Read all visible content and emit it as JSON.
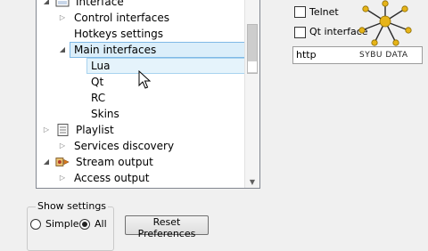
{
  "tree": {
    "items": [
      {
        "label": "Interface",
        "indent": 0,
        "arrow": "expanded",
        "icon": "interface-icon"
      },
      {
        "label": "Control interfaces",
        "indent": 1,
        "arrow": "collapsed"
      },
      {
        "label": "Hotkeys settings",
        "indent": 1,
        "arrow": "none"
      },
      {
        "label": "Main interfaces",
        "indent": 1,
        "arrow": "expanded",
        "state": "selected"
      },
      {
        "label": "Lua",
        "indent": 2,
        "arrow": "none",
        "state": "hover"
      },
      {
        "label": "Qt",
        "indent": 2,
        "arrow": "none"
      },
      {
        "label": "RC",
        "indent": 2,
        "arrow": "none"
      },
      {
        "label": "Skins",
        "indent": 2,
        "arrow": "none"
      },
      {
        "label": "Playlist",
        "indent": 0,
        "arrow": "collapsed",
        "icon": "playlist-icon"
      },
      {
        "label": "Services discovery",
        "indent": 1,
        "arrow": "collapsed"
      },
      {
        "label": "Stream output",
        "indent": 0,
        "arrow": "expanded",
        "icon": "stream-output-icon"
      },
      {
        "label": "Access output",
        "indent": 1,
        "arrow": "collapsed"
      }
    ]
  },
  "show_settings": {
    "title": "Show settings",
    "simple_label": "Simple",
    "all_label": "All",
    "selected": "All"
  },
  "reset_button_label": "Reset Preferences",
  "main_interfaces_panel": {
    "telnet_label": "Telnet",
    "qt_interface_label": "Qt interface",
    "combo_value": "http",
    "combo_watermark": "SYBU DATA"
  },
  "colors": {
    "selection": "#dbeefa",
    "hover": "#e5f3fb",
    "window": "#f0f0f0"
  }
}
